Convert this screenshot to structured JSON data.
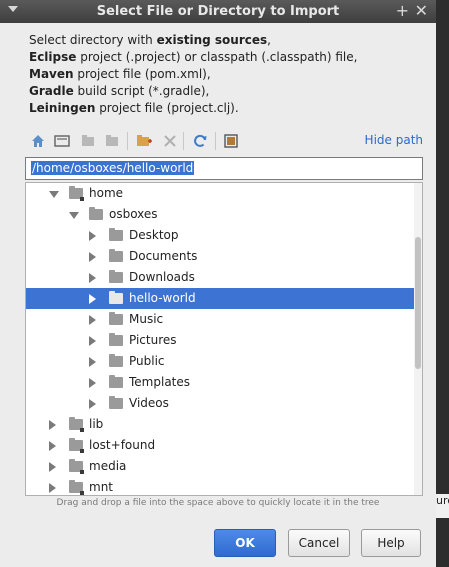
{
  "window": {
    "title": "Select File or Directory to Import"
  },
  "description": {
    "line1_pre": "Select directory with ",
    "line1_bold": "existing sources",
    "line1_post": ",",
    "line2_bold": "Eclipse",
    "line2_rest": " project (.project) or classpath (.classpath) file,",
    "line3_bold": "Maven",
    "line3_rest": " project file (pom.xml),",
    "line4_bold": "Gradle",
    "line4_rest": " build script (*.gradle),",
    "line5_bold": "Leiningen",
    "line5_rest": " project file (project.clj)."
  },
  "toolbar": {
    "hide_path": "Hide path"
  },
  "path": {
    "value": "/home/osboxes/hello-world"
  },
  "tree": {
    "rows": [
      {
        "label": "home",
        "expanded": true
      },
      {
        "label": "osboxes",
        "expanded": true
      },
      {
        "label": "Desktop"
      },
      {
        "label": "Documents"
      },
      {
        "label": "Downloads"
      },
      {
        "label": "hello-world",
        "selected": true
      },
      {
        "label": "Music"
      },
      {
        "label": "Pictures"
      },
      {
        "label": "Public"
      },
      {
        "label": "Templates"
      },
      {
        "label": "Videos"
      },
      {
        "label": "lib"
      },
      {
        "label": "lost+found"
      },
      {
        "label": "media"
      },
      {
        "label": "mnt"
      }
    ]
  },
  "hint": "Drag and drop a file into the space above to quickly locate it in the tree",
  "buttons": {
    "ok": "OK",
    "cancel": "Cancel",
    "help": "Help"
  },
  "background_edge_text": "ure",
  "colors": {
    "selection": "#3d74d4",
    "link": "#2a6bc9",
    "ok_button": "#3a78dc"
  }
}
